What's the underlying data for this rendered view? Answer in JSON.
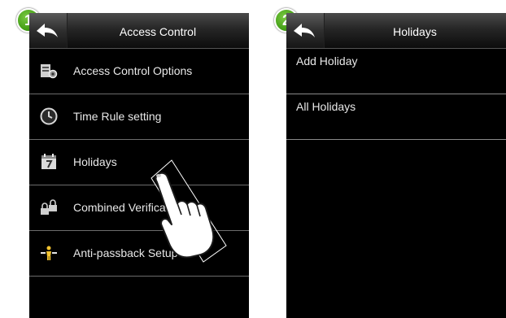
{
  "screens": [
    {
      "step": "1",
      "title": "Access Control",
      "items": [
        {
          "label": "Access Control Options",
          "icon": "access-options-icon"
        },
        {
          "label": "Time Rule setting",
          "icon": "clock-icon"
        },
        {
          "label": "Holidays",
          "icon": "calendar-icon"
        },
        {
          "label": "Combined Verification",
          "icon": "combined-lock-icon"
        },
        {
          "label": "Anti-passback Setup",
          "icon": "anti-passback-icon"
        }
      ]
    },
    {
      "step": "2",
      "title": "Holidays",
      "items": [
        {
          "label": "Add Holiday"
        },
        {
          "label": "All Holidays"
        }
      ]
    }
  ],
  "colors": {
    "badge": "#3f9b12",
    "screen_bg": "#000000",
    "text": "#e8e8e8"
  },
  "gesture": "tap-hand-pointer"
}
